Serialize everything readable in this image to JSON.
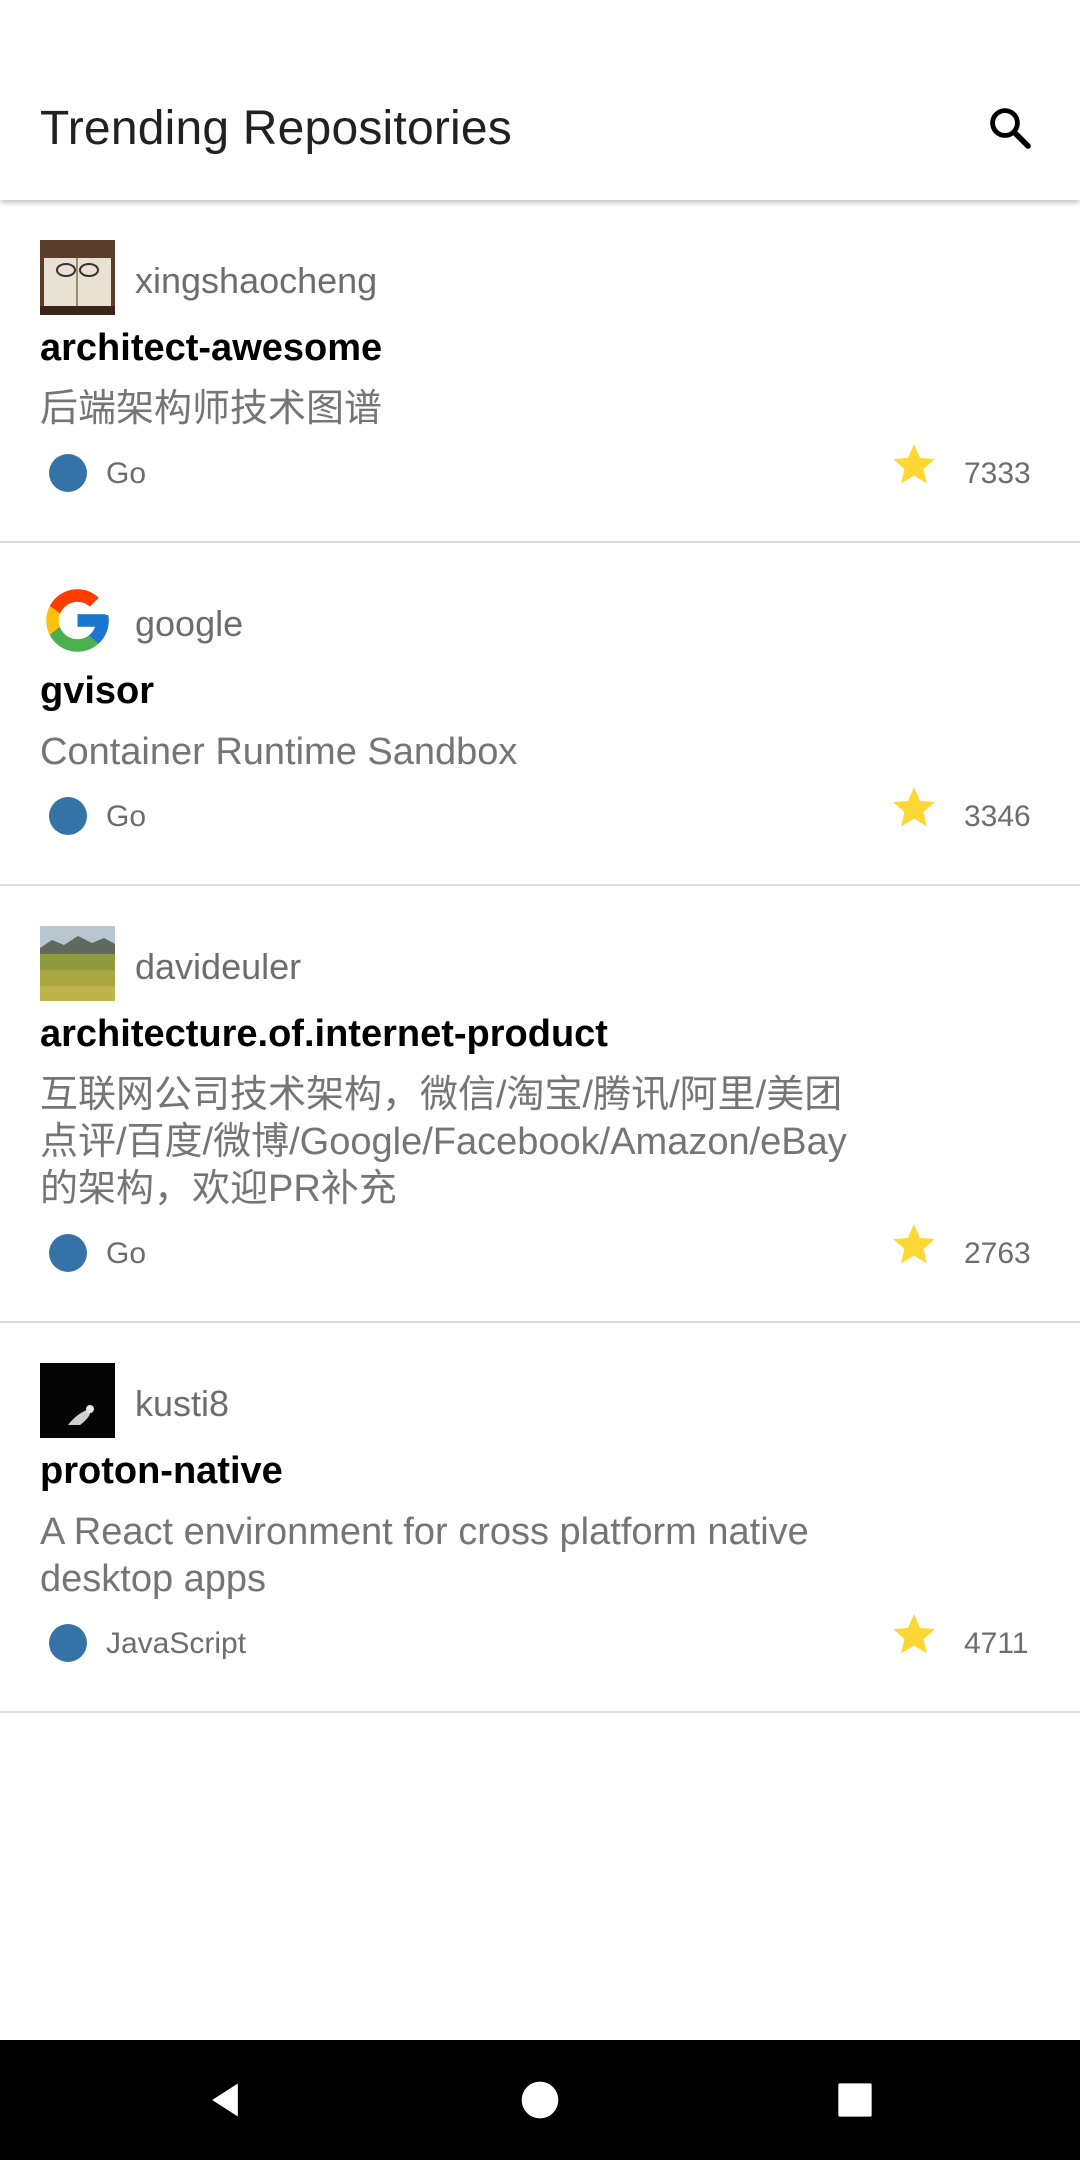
{
  "app_bar": {
    "title": "Trending Repositories",
    "search_icon": "search-icon"
  },
  "colors": {
    "go": "#3572A5",
    "star": "#FDD835",
    "divider": "#dcdcdc"
  },
  "repos": [
    {
      "owner": "xingshaocheng",
      "name": "architect-awesome",
      "description": "后端架构师技术图谱",
      "language": "Go",
      "stars": "7333"
    },
    {
      "owner": "google",
      "name": "gvisor",
      "description": "Container Runtime Sandbox",
      "language": "Go",
      "stars": "3346"
    },
    {
      "owner": "davideuler",
      "name": "architecture.of.internet-product",
      "description": "互联网公司技术架构，微信/淘宝/腾讯/阿里/美团\n点评/百度/微博/Google/Facebook/Amazon/eBay\n的架构，欢迎PR补充",
      "language": "Go",
      "stars": "2763"
    },
    {
      "owner": "kusti8",
      "name": "proton-native",
      "description": "A React environment for cross platform native\ndesktop apps",
      "language": "JavaScript",
      "stars": "4711"
    }
  ],
  "nav": {
    "back": "back-icon",
    "home": "home-icon",
    "recents": "recents-icon"
  }
}
